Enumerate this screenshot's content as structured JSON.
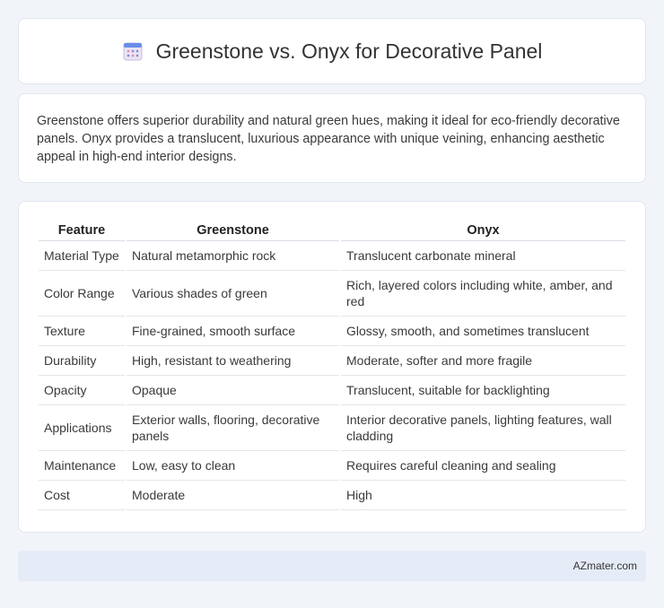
{
  "header": {
    "title": "Greenstone vs. Onyx for Decorative Panel",
    "icon": "calendar-grid-icon"
  },
  "intro": {
    "text": "Greenstone offers superior durability and natural green hues, making it ideal for eco-friendly decorative panels. Onyx provides a translucent, luxurious appearance with unique veining, enhancing aesthetic appeal in high-end interior designs."
  },
  "table": {
    "headers": [
      "Feature",
      "Greenstone",
      "Onyx"
    ],
    "rows": [
      [
        "Material Type",
        "Natural metamorphic rock",
        "Translucent carbonate mineral"
      ],
      [
        "Color Range",
        "Various shades of green",
        "Rich, layered colors including white, amber, and red"
      ],
      [
        "Texture",
        "Fine-grained, smooth surface",
        "Glossy, smooth, and sometimes translucent"
      ],
      [
        "Durability",
        "High, resistant to weathering",
        "Moderate, softer and more fragile"
      ],
      [
        "Opacity",
        "Opaque",
        "Translucent, suitable for backlighting"
      ],
      [
        "Applications",
        "Exterior walls, flooring, decorative panels",
        "Interior decorative panels, lighting features, wall cladding"
      ],
      [
        "Maintenance",
        "Low, easy to clean",
        "Requires careful cleaning and sealing"
      ],
      [
        "Cost",
        "Moderate",
        "High"
      ]
    ]
  },
  "footer": {
    "brand": "AZmater.com"
  }
}
